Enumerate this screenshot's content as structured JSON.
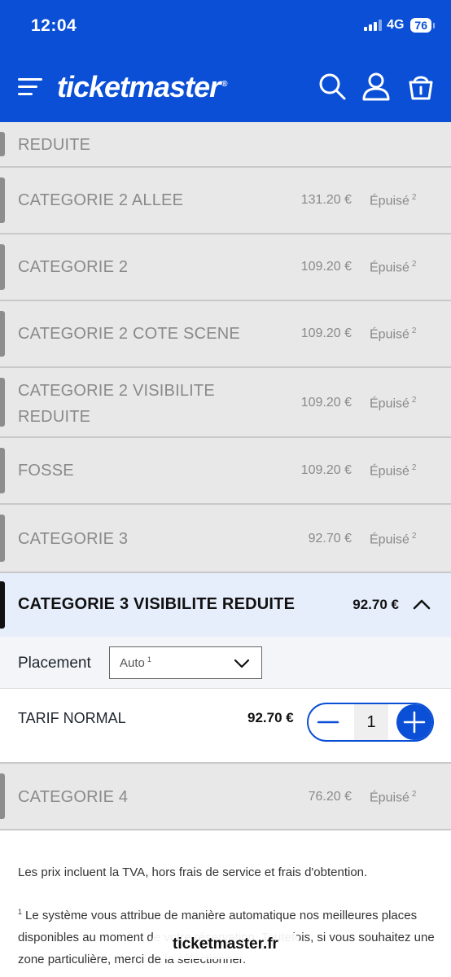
{
  "status_bar": {
    "time": "12:04",
    "network": "4G",
    "battery": "76"
  },
  "header": {
    "logo": "ticketmaster",
    "logo_mark": "®",
    "icons": [
      "menu-icon",
      "search-icon",
      "user-icon",
      "basket-icon"
    ]
  },
  "categories_top": [
    {
      "name": "REDUITE",
      "price": "",
      "status": ""
    },
    {
      "name": "CATEGORIE 2 ALLEE",
      "price": "131.20 €",
      "status": "Épuisé",
      "note": "2"
    },
    {
      "name": "CATEGORIE 2",
      "price": "109.20 €",
      "status": "Épuisé",
      "note": "2"
    },
    {
      "name": "CATEGORIE 2 COTE SCENE",
      "price": "109.20 €",
      "status": "Épuisé",
      "note": "2"
    },
    {
      "name_line1": "CATEGORIE 2 VISIBILITE",
      "name_line2": "REDUITE",
      "price": "109.20 €",
      "status": "Épuisé",
      "note": "2"
    },
    {
      "name": "FOSSE",
      "price": "109.20 €",
      "status": "Épuisé",
      "note": "2"
    },
    {
      "name": "CATEGORIE 3",
      "price": "92.70 €",
      "status": "Épuisé",
      "note": "2"
    }
  ],
  "selected_category": {
    "name": "CATEGORIE 3 VISIBILITE REDUITE",
    "price": "92.70 €",
    "placement_label": "Placement",
    "placement_value": "Auto",
    "placement_note": "1",
    "tarif_label": "TARIF NORMAL",
    "tarif_price": "92.70 €",
    "quantity": "1"
  },
  "categories_bottom": [
    {
      "name": "CATEGORIE 4",
      "price": "76.20 €",
      "status": "Épuisé",
      "note": "2"
    }
  ],
  "footnotes": {
    "tva": "Les prix incluent la TVA, hors frais de service et frais d'obtention.",
    "note1_marker": "1",
    "note1_text": "Le système vous attribue de manière automatique nos meilleures places disponibles au moment de votre réservation. Toutefois, si vous souhaitez une zone particulière, merci de la sélectionner."
  },
  "url_bar": "ticketmaster.fr",
  "colors": {
    "brand": "#0a4fd6",
    "row_bg": "#e8e8e8",
    "selected_bg": "#e6edfb"
  }
}
